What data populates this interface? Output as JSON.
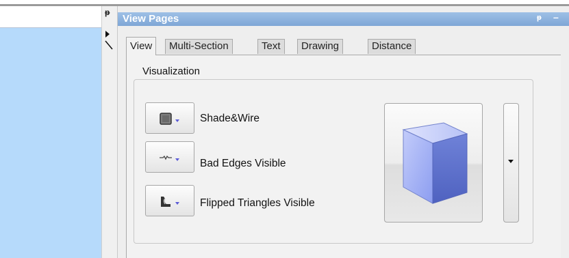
{
  "panel": {
    "title": "View Pages"
  },
  "tabs": [
    {
      "label": "View",
      "active": true
    },
    {
      "label": "Multi-Section"
    },
    {
      "label": "Text"
    },
    {
      "label": "Drawing"
    },
    {
      "label": "Distance"
    }
  ],
  "visualization": {
    "group_label": "Visualization",
    "options": [
      {
        "label": "Shade&Wire",
        "icon": "shade-wire-icon"
      },
      {
        "label": "Bad Edges Visible",
        "icon": "bad-edges-icon"
      },
      {
        "label": "Flipped Triangles Visible",
        "icon": "flipped-triangles-icon"
      }
    ],
    "preview_icon": "cube-icon"
  },
  "colors": {
    "titlebar": "#8bb2df",
    "left_panel": "#b6dafb",
    "cube": "#9fb0f2",
    "caret_accent": "#5b5bd6"
  }
}
